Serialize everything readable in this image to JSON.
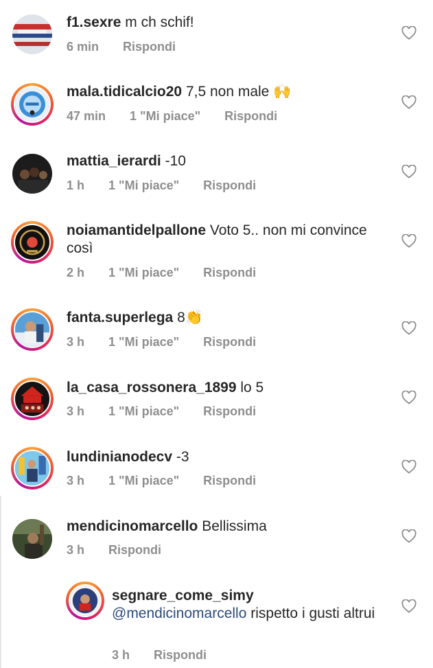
{
  "comments": [
    {
      "user": "f1.sexre",
      "text": "m ch schif!",
      "time": "6 min",
      "likes": "",
      "reply": "Rispondi"
    },
    {
      "user": "mala.tidicalcio20",
      "text": "7,5 non male 🙌",
      "time": "47 min",
      "likes": "1 \"Mi piace\"",
      "reply": "Rispondi"
    },
    {
      "user": "mattia_ierardi",
      "text": "-10",
      "time": "1 h",
      "likes": "1 \"Mi piace\"",
      "reply": "Rispondi"
    },
    {
      "user": "noiamantidelpallone",
      "text": "Voto 5.. non mi convince così",
      "time": "2 h",
      "likes": "1 \"Mi piace\"",
      "reply": "Rispondi"
    },
    {
      "user": "fanta.superlega",
      "text": "8👏",
      "time": "3 h",
      "likes": "1 \"Mi piace\"",
      "reply": "Rispondi"
    },
    {
      "user": "la_casa_rossonera_1899",
      "text": "lo 5",
      "time": "3 h",
      "likes": "1 \"Mi piace\"",
      "reply": "Rispondi"
    },
    {
      "user": "lundinianodecv",
      "text": "-3",
      "time": "3 h",
      "likes": "1 \"Mi piace\"",
      "reply": "Rispondi"
    },
    {
      "user": "mendicinomarcello",
      "text": "Bellissima",
      "time": "3 h",
      "likes": "",
      "reply": "Rispondi"
    },
    {
      "user": "segnare_come_simy",
      "mention": "@mendicinomarcello",
      "text": "rispetto i gusti altrui",
      "time": "3 h",
      "likes": "",
      "reply": "Rispondi"
    }
  ]
}
